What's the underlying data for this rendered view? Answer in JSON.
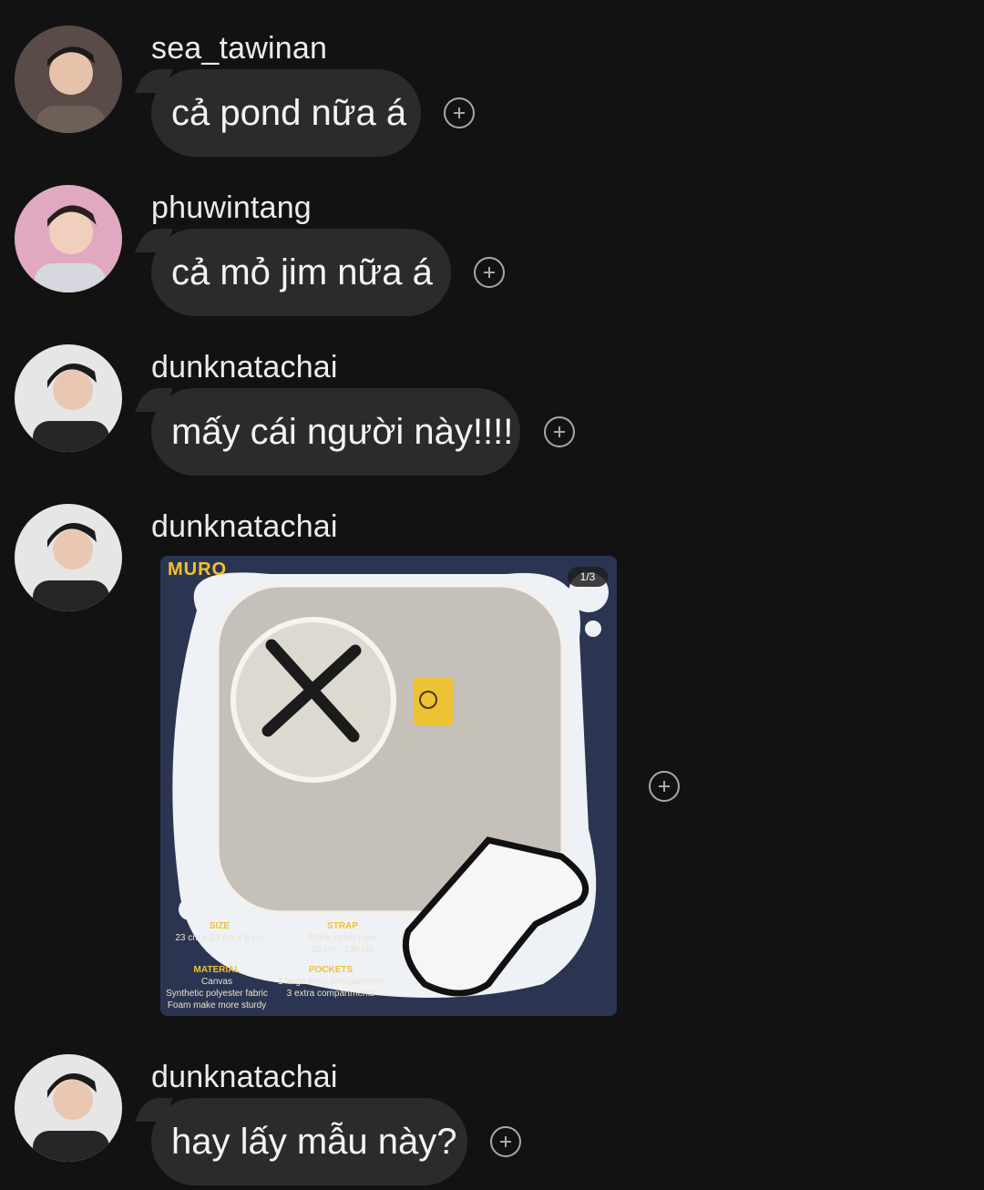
{
  "messages": [
    {
      "username": "sea_tawinan",
      "text": "cả pond nữa á"
    },
    {
      "username": "phuwintang",
      "text": "cả mỏ jim nữa á"
    },
    {
      "username": "dunknatachai",
      "text": "mấy cái người này!!!!"
    },
    {
      "username": "dunknatachai",
      "image": {
        "brand": "MURO",
        "counter": "1/3",
        "specs": {
          "size_title": "SIZE",
          "size_value": "23 cm x 23 cm x 8 cm",
          "strap_title": "STRAP",
          "strap_line1": "Black nylon rope",
          "strap_line2": "65 cm - 130 cm",
          "material_title": "MATERIAL",
          "material_line1": "Canvas",
          "material_line2": "Synthetic polyester fabric",
          "material_line3": "Foam make more sturdy",
          "pockets_title": "POCKETS",
          "pockets_line1": "1 large main compartment",
          "pockets_line2": "3 extra compartments"
        }
      }
    },
    {
      "username": "dunknatachai",
      "text": "hay lấy mẫu này?"
    }
  ],
  "icons": {
    "reaction": "add-reaction-icon",
    "avatar": "profile-photo"
  },
  "colors": {
    "background": "#121212",
    "bubble": "#2b2b2b",
    "text": "#f4f4f4",
    "brand": "#f2c230"
  }
}
